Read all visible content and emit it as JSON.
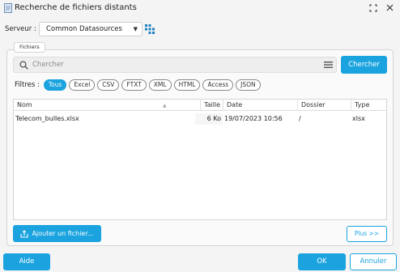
{
  "window": {
    "title": "Recherche de fichiers distants"
  },
  "server": {
    "label": "Serveur :",
    "selected": "Common Datasources"
  },
  "group": {
    "legend": "Fichiers"
  },
  "search": {
    "placeholder": "Chercher",
    "button": "Chercher"
  },
  "filters": {
    "label": "Filtres :",
    "chips": [
      "Tous",
      "Excel",
      "CSV",
      "FTXT",
      "XML",
      "HTML",
      "Access",
      "JSON"
    ],
    "active": "Tous"
  },
  "table": {
    "columns": [
      "Nom",
      "Taille",
      "Date",
      "Dossier",
      "Type"
    ],
    "rows": [
      {
        "name": "Telecom_bulles.xlsx",
        "size": "6 Ko",
        "date": "19/07/2023 10:56",
        "folder": "/",
        "type": "xlsx"
      }
    ]
  },
  "buttons": {
    "add_file": "Ajouter un fichier...",
    "more": "Plus >>",
    "help": "Aide",
    "ok": "OK",
    "cancel": "Annuler"
  },
  "colors": {
    "accent": "#1aa3df"
  },
  "icons": {
    "app": "document-icon",
    "maximize": "maximize-icon",
    "close": "close-icon",
    "tree": "tree-structure-icon",
    "search": "search-icon",
    "menu": "hamburger-menu-icon",
    "sort": "sort-ascending-icon",
    "upload": "upload-icon"
  }
}
